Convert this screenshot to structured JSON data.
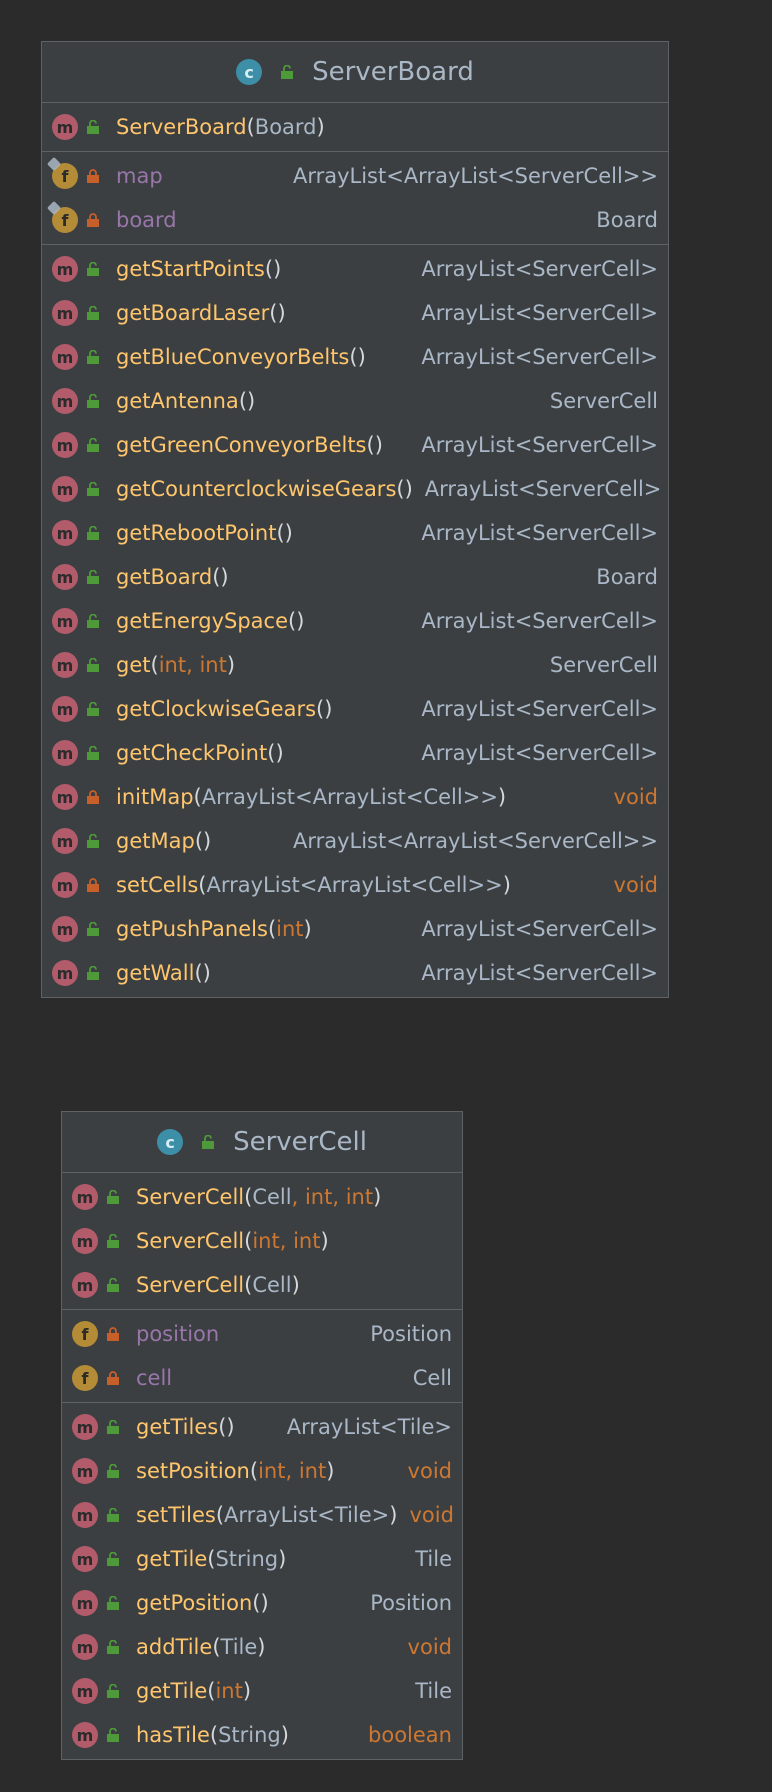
{
  "colors": {
    "background": "#2b2b2b",
    "class_box": "#3c3f41",
    "method_name": "#ffc66d",
    "field_name": "#9876aa",
    "keyword": "#cc7832",
    "text": "#a9b7c6",
    "method_badge": "#b15b6b",
    "field_badge": "#b48b36",
    "class_badge": "#3d8fa8",
    "public_icon": "#4e9a3a",
    "private_icon": "#c75f2b"
  },
  "classes": [
    {
      "name": "ServerBoard",
      "badge": "c",
      "constructors": [
        {
          "kind": "m",
          "vis": "public",
          "name": "ServerBoard",
          "params": "Board",
          "type": ""
        }
      ],
      "fields": [
        {
          "kind": "f",
          "vis": "private",
          "static": true,
          "name": "map",
          "params": null,
          "type": "ArrayList<ArrayList<ServerCell>>"
        },
        {
          "kind": "f",
          "vis": "private",
          "static": true,
          "name": "board",
          "params": null,
          "type": "Board"
        }
      ],
      "methods": [
        {
          "kind": "m",
          "vis": "public",
          "name": "getStartPoints",
          "params": "",
          "type": "ArrayList<ServerCell>"
        },
        {
          "kind": "m",
          "vis": "public",
          "name": "getBoardLaser",
          "params": "",
          "type": "ArrayList<ServerCell>"
        },
        {
          "kind": "m",
          "vis": "public",
          "name": "getBlueConveyorBelts",
          "params": "",
          "type": "ArrayList<ServerCell>"
        },
        {
          "kind": "m",
          "vis": "public",
          "name": "getAntenna",
          "params": "",
          "type": "ServerCell"
        },
        {
          "kind": "m",
          "vis": "public",
          "name": "getGreenConveyorBelts",
          "params": "",
          "type": "ArrayList<ServerCell>"
        },
        {
          "kind": "m",
          "vis": "public",
          "name": "getCounterclockwiseGears",
          "params": "",
          "type": "ArrayList<ServerCell>"
        },
        {
          "kind": "m",
          "vis": "public",
          "name": "getRebootPoint",
          "params": "",
          "type": "ArrayList<ServerCell>"
        },
        {
          "kind": "m",
          "vis": "public",
          "name": "getBoard",
          "params": "",
          "type": "Board"
        },
        {
          "kind": "m",
          "vis": "public",
          "name": "getEnergySpace",
          "params": "",
          "type": "ArrayList<ServerCell>"
        },
        {
          "kind": "m",
          "vis": "public",
          "name": "get",
          "params": "int, int",
          "type": "ServerCell"
        },
        {
          "kind": "m",
          "vis": "public",
          "name": "getClockwiseGears",
          "params": "",
          "type": "ArrayList<ServerCell>"
        },
        {
          "kind": "m",
          "vis": "public",
          "name": "getCheckPoint",
          "params": "",
          "type": "ArrayList<ServerCell>"
        },
        {
          "kind": "m",
          "vis": "private",
          "name": "initMap",
          "params": "ArrayList<ArrayList<Cell>>",
          "type": "void"
        },
        {
          "kind": "m",
          "vis": "public",
          "name": "getMap",
          "params": "",
          "type": "ArrayList<ArrayList<ServerCell>>"
        },
        {
          "kind": "m",
          "vis": "private",
          "name": "setCells",
          "params": "ArrayList<ArrayList<Cell>>",
          "type": "void"
        },
        {
          "kind": "m",
          "vis": "public",
          "name": "getPushPanels",
          "params": "int",
          "type": "ArrayList<ServerCell>"
        },
        {
          "kind": "m",
          "vis": "public",
          "name": "getWall",
          "params": "",
          "type": "ArrayList<ServerCell>"
        }
      ]
    },
    {
      "name": "ServerCell",
      "badge": "c",
      "constructors": [
        {
          "kind": "m",
          "vis": "public",
          "name": "ServerCell",
          "params": "Cell, int, int",
          "type": ""
        },
        {
          "kind": "m",
          "vis": "public",
          "name": "ServerCell",
          "params": "int, int",
          "type": ""
        },
        {
          "kind": "m",
          "vis": "public",
          "name": "ServerCell",
          "params": "Cell",
          "type": ""
        }
      ],
      "fields": [
        {
          "kind": "f",
          "vis": "private",
          "static": false,
          "name": "position",
          "params": null,
          "type": "Position"
        },
        {
          "kind": "f",
          "vis": "private",
          "static": false,
          "name": "cell",
          "params": null,
          "type": "Cell"
        }
      ],
      "methods": [
        {
          "kind": "m",
          "vis": "public",
          "name": "getTiles",
          "params": "",
          "type": "ArrayList<Tile>"
        },
        {
          "kind": "m",
          "vis": "public",
          "name": "setPosition",
          "params": "int, int",
          "type": "void"
        },
        {
          "kind": "m",
          "vis": "public",
          "name": "setTiles",
          "params": "ArrayList<Tile>",
          "type": "void"
        },
        {
          "kind": "m",
          "vis": "public",
          "name": "getTile",
          "params": "String",
          "type": "Tile"
        },
        {
          "kind": "m",
          "vis": "public",
          "name": "getPosition",
          "params": "",
          "type": "Position"
        },
        {
          "kind": "m",
          "vis": "public",
          "name": "addTile",
          "params": "Tile",
          "type": "void"
        },
        {
          "kind": "m",
          "vis": "public",
          "name": "getTile",
          "params": "int",
          "type": "Tile"
        },
        {
          "kind": "m",
          "vis": "public",
          "name": "hasTile",
          "params": "String",
          "type": "boolean"
        }
      ]
    }
  ]
}
